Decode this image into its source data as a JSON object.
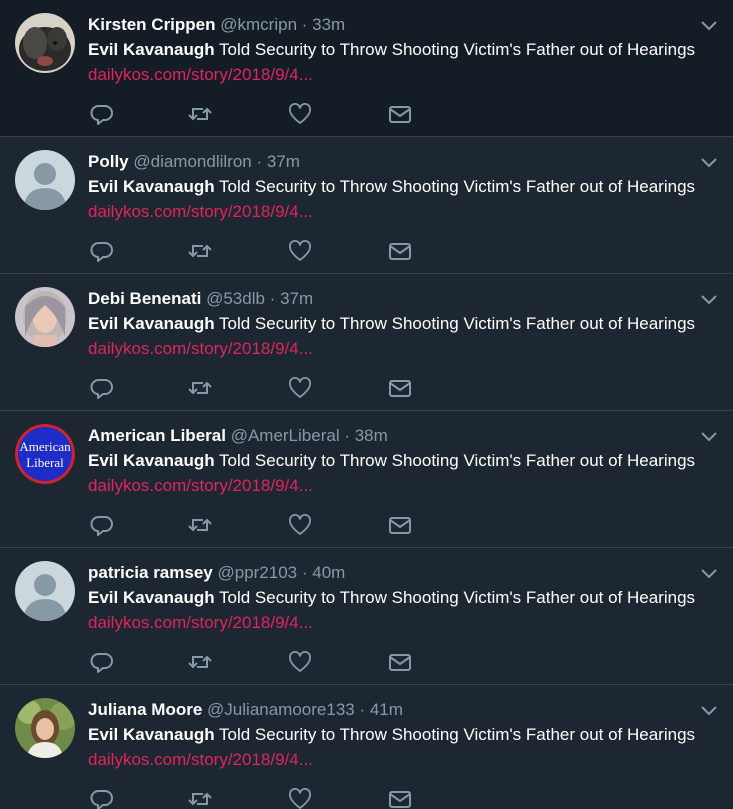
{
  "colors": {
    "background": "#1c2732",
    "first_tweet_background": "#141d26",
    "divider": "#38444d",
    "name": "#ffffff",
    "muted": "#8899a6",
    "link": "#e0245e"
  },
  "tweets": [
    {
      "name": "Kirsten Crippen",
      "handle": "@kmcripn",
      "time": "33m",
      "title_bold": "Evil Kavanaugh",
      "title_rest": " Told Security to Throw Shooting Victim's Father out of Hearings",
      "link": "dailykos.com/story/2018/9/4...",
      "avatar": "dog-photo"
    },
    {
      "name": "Polly",
      "handle": "@diamondlilron",
      "time": "37m",
      "title_bold": "Evil Kavanaugh",
      "title_rest": " Told Security to Throw Shooting Victim's Father out of Hearings",
      "link": "dailykos.com/story/2018/9/4...",
      "avatar": "default-silhouette"
    },
    {
      "name": "Debi Benenati",
      "handle": "@53dlb",
      "time": "37m",
      "title_bold": "Evil Kavanaugh",
      "title_rest": " Told Security to Throw Shooting Victim's Father out of Hearings",
      "link": "dailykos.com/story/2018/9/4...",
      "avatar": "woman-photo"
    },
    {
      "name": "American Liberal",
      "handle": "@AmerLiberal",
      "time": "38m",
      "title_bold": "Evil Kavanaugh",
      "title_rest": " Told Security to Throw Shooting Victim's Father out of Hearings",
      "link": "dailykos.com/story/2018/9/4...",
      "avatar": "american-liberal-logo",
      "avatar_text": [
        "American",
        "Liberal"
      ]
    },
    {
      "name": "patricia ramsey",
      "handle": "@ppr2103",
      "time": "40m",
      "title_bold": "Evil Kavanaugh",
      "title_rest": " Told Security to Throw Shooting Victim's Father out of Hearings",
      "link": "dailykos.com/story/2018/9/4...",
      "avatar": "default-silhouette"
    },
    {
      "name": "Juliana Moore",
      "handle": "@Julianamoore133",
      "time": "41m",
      "title_bold": "Evil Kavanaugh",
      "title_rest": " Told Security to Throw Shooting Victim's Father out of Hearings",
      "link": "dailykos.com/story/2018/9/4...",
      "avatar": "woman-outdoor-photo"
    }
  ],
  "icons": {
    "reply": "reply-icon",
    "retweet": "retweet-icon",
    "like": "like-icon",
    "dm": "direct-message-icon",
    "more": "chevron-down-icon"
  }
}
